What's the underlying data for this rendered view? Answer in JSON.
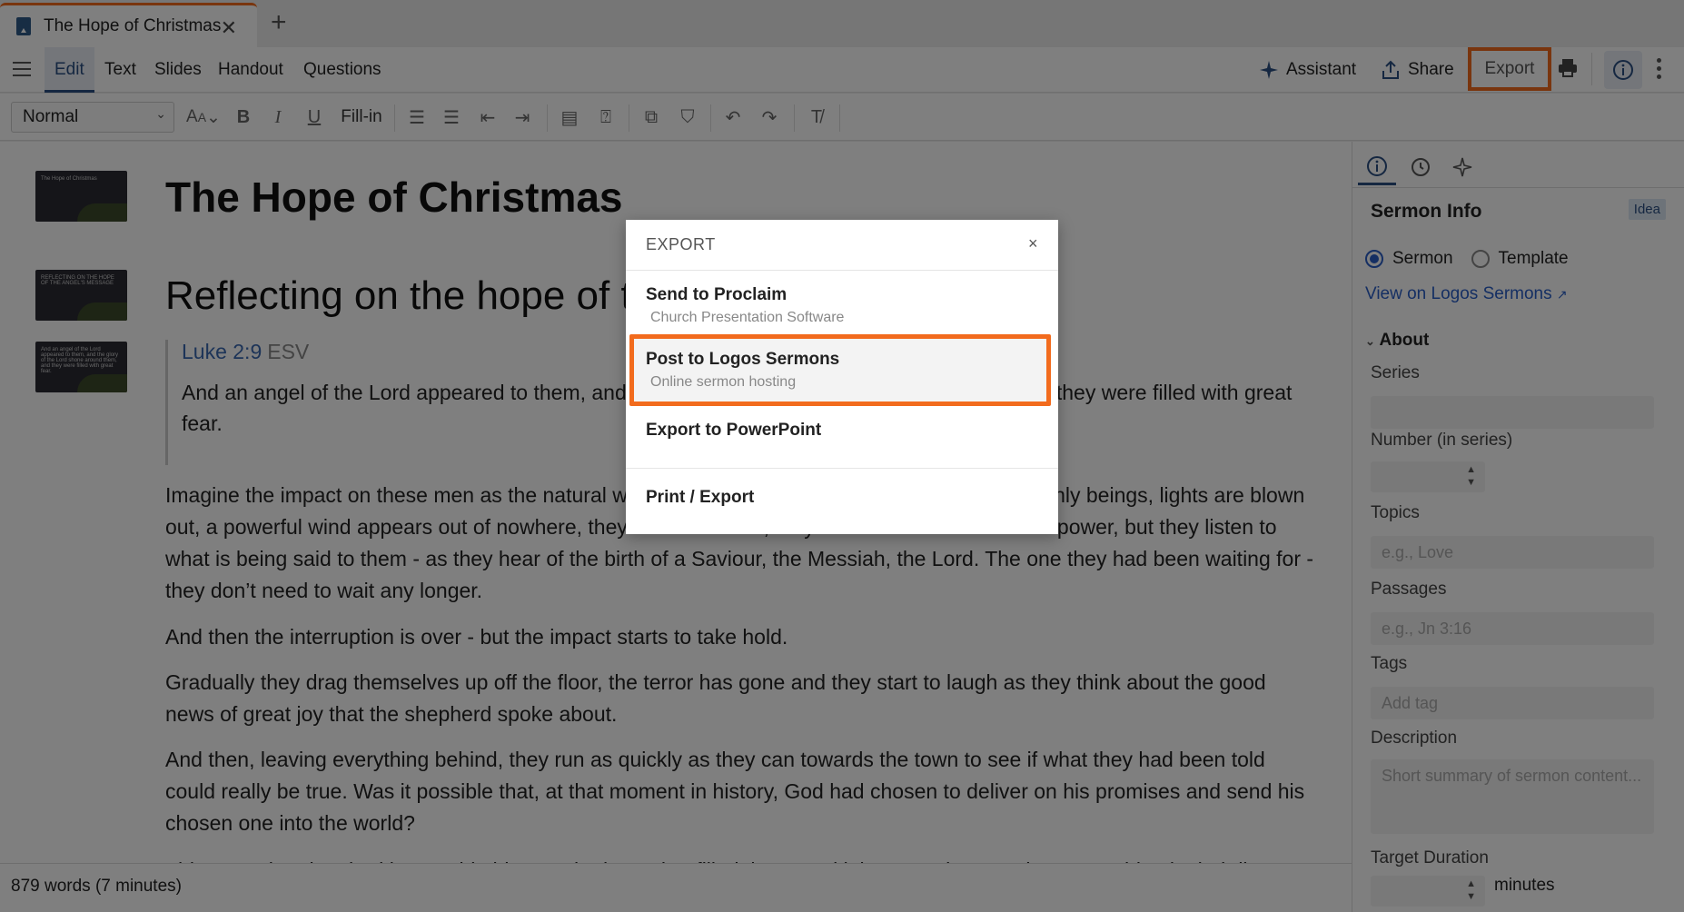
{
  "browser": {
    "tab_title": "The Hope of Christmas",
    "close_glyph": "✕",
    "new_tab_glyph": "+"
  },
  "toolbar": {
    "tabs": [
      "Edit",
      "Text",
      "Slides",
      "Handout",
      "Questions"
    ],
    "active_tab": "Edit",
    "assistant_label": "Assistant",
    "share_label": "Share",
    "export_label": "Export"
  },
  "format_bar": {
    "style_value": "Normal",
    "fill_in_label": "Fill-in"
  },
  "document": {
    "title": "The Hope of Christmas",
    "heading": "Reflecting on the hope of the Angel's message",
    "scripture_ref": "Luke 2:9",
    "scripture_version": "ESV",
    "scripture_text": "And an angel of the Lord appeared to them, and the glory of the Lord shone around them, and they were filled with great fear.",
    "paragraphs": [
      "Imagine the impact on these men as the natural world is interrupted by the appearance of heavenly beings, lights are blown out, a powerful wind appears out of nowhere, they fall to the floor, they cower in the face of such power, but they listen to what is being said to them - as they hear of the birth of a Saviour, the Messiah, the Lord. The one they had been waiting for - they don’t need to wait any longer.",
      "And then the interruption is over - but the impact starts to take hold.",
      "Gradually they drag themselves up off the floor, the terror has gone and they start to laugh as they think about the good news of great joy that the shepherd spoke about.",
      "And then, leaving everything behind, they run as quickly as they can towards the town to see if what they had been told could really be true. Was it possible that, at that moment in history, God had chosen to deliver on his promises and send his chosen one into the world?",
      "This was what they had been told, this was the hope that filled them, and it became the most important thing in their lives."
    ],
    "thumbnails": [
      "The Hope of Christmas",
      "REFLECTING ON THE HOPE OF THE ANGEL'S MESSAGE",
      "And an angel of the Lord appeared to them, and the glory of the Lord shone around them, and they were filled with great fear."
    ],
    "word_count": "879 words (7 minutes)"
  },
  "panel": {
    "title": "Sermon Info",
    "badge": "Idea",
    "type_options": [
      "Sermon",
      "Template"
    ],
    "selected_type": "Sermon",
    "view_link": "View on Logos Sermons",
    "section": "About",
    "fields": {
      "series": "Series",
      "number": "Number (in series)",
      "topics": "Topics",
      "topics_placeholder": "e.g., Love",
      "passages": "Passages",
      "passages_placeholder": "e.g., Jn 3:16",
      "tags": "Tags",
      "tags_placeholder": "Add tag",
      "description": "Description",
      "description_placeholder": "Short summary of sermon content...",
      "target_duration": "Target Duration",
      "minutes": "minutes"
    }
  },
  "export_dialog": {
    "title": "EXPORT",
    "close_glyph": "×",
    "items": [
      {
        "label": "Send to Proclaim",
        "sub": "Church Presentation Software"
      },
      {
        "label": "Post to Logos Sermons",
        "sub": "Online sermon hosting"
      },
      {
        "label": "Export to PowerPoint",
        "sub": ""
      },
      {
        "label": "Print / Export",
        "sub": ""
      }
    ],
    "highlighted_index": 1
  },
  "colors": {
    "highlight": "#f26b1d",
    "accent": "#2a4f82",
    "link": "#2a5ec7"
  }
}
